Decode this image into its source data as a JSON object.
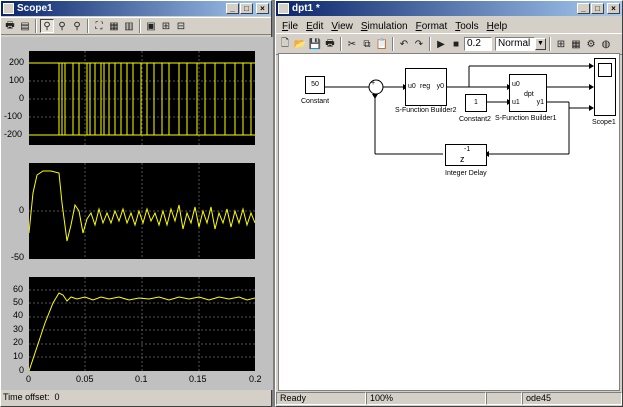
{
  "scope": {
    "title": "Scope1",
    "time_offset_label": "Time offset:",
    "time_offset_value": "0",
    "plots": [
      {
        "yticks": [
          "200",
          "100",
          "0",
          "-100",
          "-200"
        ]
      },
      {
        "yticks": [
          "0",
          "-50"
        ]
      },
      {
        "yticks": [
          "60",
          "50",
          "40",
          "30",
          "20",
          "10",
          "0"
        ]
      }
    ],
    "xticks": [
      "0",
      "0.05",
      "0.1",
      "0.15",
      "0.2"
    ],
    "colors": {
      "trace": "#ffff00",
      "bg": "#000000",
      "frame": "#c0c0c0"
    }
  },
  "model": {
    "title": "dpt1 *",
    "menu": [
      "File",
      "Edit",
      "View",
      "Simulation",
      "Format",
      "Tools",
      "Help"
    ],
    "stop_time": "0.2",
    "sim_mode": "Normal",
    "blocks": {
      "constant_value": "50",
      "constant_label": "Constant",
      "sum_sign": "+",
      "sfb2_in": "u0",
      "sfb2_mid": "reg",
      "sfb2_out": "y0",
      "sfb2_label": "S-Function Builder2",
      "constant2_value": "1",
      "constant2_label": "Constant2",
      "sfb1_in0": "u0",
      "sfb1_in1": "u1",
      "sfb1_mid": "dpt",
      "sfb1_out": "y1",
      "sfb1_label": "S-Function Builder1",
      "scope_label": "Scope1",
      "delay_exp": "-1",
      "delay_z": "z",
      "delay_label": "Integer Delay"
    },
    "status": {
      "ready": "Ready",
      "zoom": "100%",
      "solver": "ode45"
    }
  }
}
